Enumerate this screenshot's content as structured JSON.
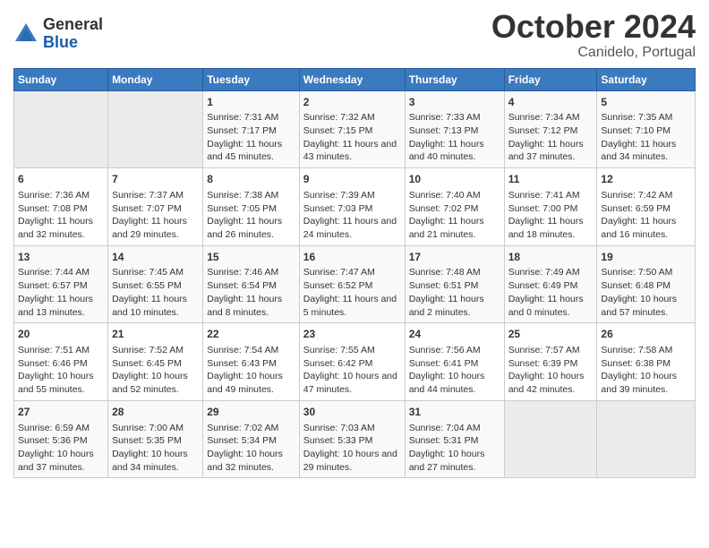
{
  "header": {
    "logo_general": "General",
    "logo_blue": "Blue",
    "title": "October 2024",
    "subtitle": "Canidelo, Portugal"
  },
  "weekdays": [
    "Sunday",
    "Monday",
    "Tuesday",
    "Wednesday",
    "Thursday",
    "Friday",
    "Saturday"
  ],
  "weeks": [
    [
      {
        "day": "",
        "content": ""
      },
      {
        "day": "",
        "content": ""
      },
      {
        "day": "1",
        "content": "Sunrise: 7:31 AM\nSunset: 7:17 PM\nDaylight: 11 hours and 45 minutes."
      },
      {
        "day": "2",
        "content": "Sunrise: 7:32 AM\nSunset: 7:15 PM\nDaylight: 11 hours and 43 minutes."
      },
      {
        "day": "3",
        "content": "Sunrise: 7:33 AM\nSunset: 7:13 PM\nDaylight: 11 hours and 40 minutes."
      },
      {
        "day": "4",
        "content": "Sunrise: 7:34 AM\nSunset: 7:12 PM\nDaylight: 11 hours and 37 minutes."
      },
      {
        "day": "5",
        "content": "Sunrise: 7:35 AM\nSunset: 7:10 PM\nDaylight: 11 hours and 34 minutes."
      }
    ],
    [
      {
        "day": "6",
        "content": "Sunrise: 7:36 AM\nSunset: 7:08 PM\nDaylight: 11 hours and 32 minutes."
      },
      {
        "day": "7",
        "content": "Sunrise: 7:37 AM\nSunset: 7:07 PM\nDaylight: 11 hours and 29 minutes."
      },
      {
        "day": "8",
        "content": "Sunrise: 7:38 AM\nSunset: 7:05 PM\nDaylight: 11 hours and 26 minutes."
      },
      {
        "day": "9",
        "content": "Sunrise: 7:39 AM\nSunset: 7:03 PM\nDaylight: 11 hours and 24 minutes."
      },
      {
        "day": "10",
        "content": "Sunrise: 7:40 AM\nSunset: 7:02 PM\nDaylight: 11 hours and 21 minutes."
      },
      {
        "day": "11",
        "content": "Sunrise: 7:41 AM\nSunset: 7:00 PM\nDaylight: 11 hours and 18 minutes."
      },
      {
        "day": "12",
        "content": "Sunrise: 7:42 AM\nSunset: 6:59 PM\nDaylight: 11 hours and 16 minutes."
      }
    ],
    [
      {
        "day": "13",
        "content": "Sunrise: 7:44 AM\nSunset: 6:57 PM\nDaylight: 11 hours and 13 minutes."
      },
      {
        "day": "14",
        "content": "Sunrise: 7:45 AM\nSunset: 6:55 PM\nDaylight: 11 hours and 10 minutes."
      },
      {
        "day": "15",
        "content": "Sunrise: 7:46 AM\nSunset: 6:54 PM\nDaylight: 11 hours and 8 minutes."
      },
      {
        "day": "16",
        "content": "Sunrise: 7:47 AM\nSunset: 6:52 PM\nDaylight: 11 hours and 5 minutes."
      },
      {
        "day": "17",
        "content": "Sunrise: 7:48 AM\nSunset: 6:51 PM\nDaylight: 11 hours and 2 minutes."
      },
      {
        "day": "18",
        "content": "Sunrise: 7:49 AM\nSunset: 6:49 PM\nDaylight: 11 hours and 0 minutes."
      },
      {
        "day": "19",
        "content": "Sunrise: 7:50 AM\nSunset: 6:48 PM\nDaylight: 10 hours and 57 minutes."
      }
    ],
    [
      {
        "day": "20",
        "content": "Sunrise: 7:51 AM\nSunset: 6:46 PM\nDaylight: 10 hours and 55 minutes."
      },
      {
        "day": "21",
        "content": "Sunrise: 7:52 AM\nSunset: 6:45 PM\nDaylight: 10 hours and 52 minutes."
      },
      {
        "day": "22",
        "content": "Sunrise: 7:54 AM\nSunset: 6:43 PM\nDaylight: 10 hours and 49 minutes."
      },
      {
        "day": "23",
        "content": "Sunrise: 7:55 AM\nSunset: 6:42 PM\nDaylight: 10 hours and 47 minutes."
      },
      {
        "day": "24",
        "content": "Sunrise: 7:56 AM\nSunset: 6:41 PM\nDaylight: 10 hours and 44 minutes."
      },
      {
        "day": "25",
        "content": "Sunrise: 7:57 AM\nSunset: 6:39 PM\nDaylight: 10 hours and 42 minutes."
      },
      {
        "day": "26",
        "content": "Sunrise: 7:58 AM\nSunset: 6:38 PM\nDaylight: 10 hours and 39 minutes."
      }
    ],
    [
      {
        "day": "27",
        "content": "Sunrise: 6:59 AM\nSunset: 5:36 PM\nDaylight: 10 hours and 37 minutes."
      },
      {
        "day": "28",
        "content": "Sunrise: 7:00 AM\nSunset: 5:35 PM\nDaylight: 10 hours and 34 minutes."
      },
      {
        "day": "29",
        "content": "Sunrise: 7:02 AM\nSunset: 5:34 PM\nDaylight: 10 hours and 32 minutes."
      },
      {
        "day": "30",
        "content": "Sunrise: 7:03 AM\nSunset: 5:33 PM\nDaylight: 10 hours and 29 minutes."
      },
      {
        "day": "31",
        "content": "Sunrise: 7:04 AM\nSunset: 5:31 PM\nDaylight: 10 hours and 27 minutes."
      },
      {
        "day": "",
        "content": ""
      },
      {
        "day": "",
        "content": ""
      }
    ]
  ]
}
